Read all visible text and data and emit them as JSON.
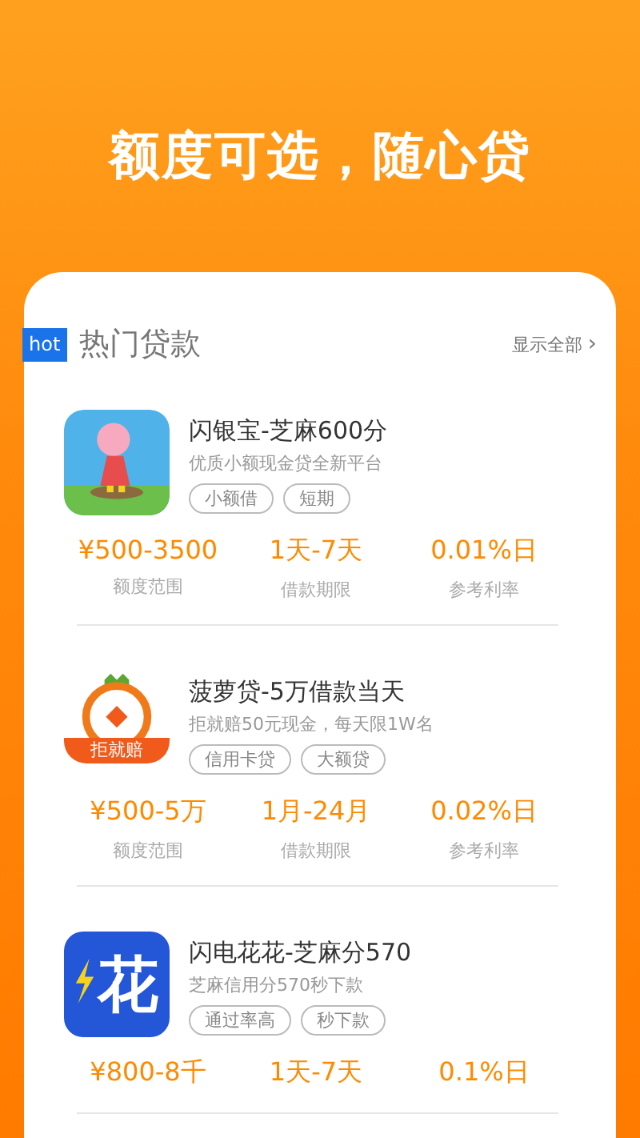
{
  "headline": "额度可选，随心贷",
  "section": {
    "badge": "hot",
    "title": "热门贷款",
    "more": "显示全部",
    "more_arrow": "›"
  },
  "loans": [
    {
      "logo": {
        "kind": "picture"
      },
      "name": "闪银宝-芝麻600分",
      "desc": "优质小额现金贷全新平台",
      "tags": [
        "小额借",
        "短期"
      ],
      "stats": [
        {
          "value": "¥500-3500",
          "label": "额度范围"
        },
        {
          "value": "1天-7天",
          "label": "借款期限"
        },
        {
          "value": "0.01%日",
          "label": "参考利率"
        }
      ]
    },
    {
      "logo": {
        "kind": "coin",
        "text": "拒就赔"
      },
      "name": "菠萝贷-5万借款当天",
      "desc": "拒就赔50元现金，每天限1W名",
      "tags": [
        "信用卡贷",
        "大额贷"
      ],
      "stats": [
        {
          "value": "¥500-5万",
          "label": "额度范围"
        },
        {
          "value": "1月-24月",
          "label": "借款期限"
        },
        {
          "value": "0.02%日",
          "label": "参考利率"
        }
      ]
    },
    {
      "logo": {
        "kind": "flash",
        "text": "花"
      },
      "name": "闪电花花-芝麻分570",
      "desc": "芝麻信用分570秒下款",
      "tags": [
        "通过率高",
        "秒下款"
      ],
      "stats": [
        {
          "value": "¥800-8千"
        },
        {
          "value": "1天-7天"
        },
        {
          "value": "0.1%日"
        }
      ]
    }
  ]
}
